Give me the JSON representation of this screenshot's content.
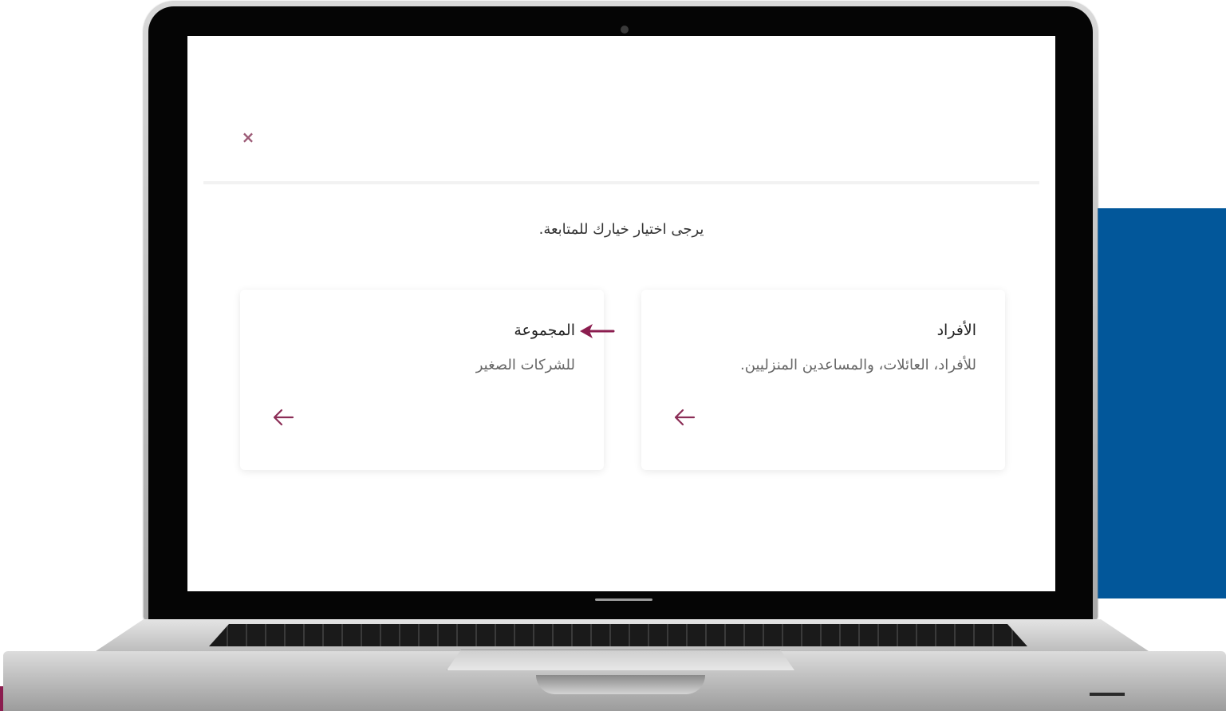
{
  "screen": {
    "close_label": "×",
    "subtitle": "يرجى اختيار خيارك للمتابعة.",
    "cards": [
      {
        "title": "الأفراد",
        "description": "للأفراد، العائلات، والمساعدين المنزليين."
      },
      {
        "title": "المجموعة",
        "description": "للشركات الصغير"
      }
    ]
  },
  "icons": {
    "close": "close-icon",
    "card_arrow": "arrow-left-icon",
    "pointer": "pointer-arrow-icon"
  },
  "colors": {
    "accent": "#8b2d56",
    "close": "#9c5a76",
    "side_panel": "#02579a",
    "strip": "#8b1d4f"
  }
}
